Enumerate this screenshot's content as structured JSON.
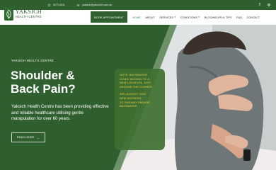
{
  "topbar": {
    "phone": "9271 6211",
    "email": "yaksich@yaksichh.com.au",
    "social": [
      {
        "name": "facebook-icon",
        "glyph": "f"
      },
      {
        "name": "instagram-icon",
        "glyph": "◎"
      }
    ]
  },
  "logo": {
    "name": "YAKSICH",
    "sub": "HEALTH CENTRE"
  },
  "nav": {
    "book_label": "BOOK APPOINTMENT",
    "items": [
      {
        "label": "HOME",
        "active": true
      },
      {
        "label": "ABOUT"
      },
      {
        "label": "SERVICES",
        "dropdown": true
      },
      {
        "label": "CONDITIONS",
        "dropdown": true
      },
      {
        "label": "BLOG/HELPFUL TIPS"
      },
      {
        "label": "FAQ"
      },
      {
        "label": "CONTACT"
      }
    ]
  },
  "hero": {
    "eyebrow": "YAKSICH HEALTH CENTRE",
    "headline_1": "Shoulder &",
    "headline_2": "Back Pain?",
    "lede": "Yaksich Health Centre has been providing effective and reliable healthcare utilising gentle manipulation for over 60 years.",
    "read_more": "READ MORE",
    "notice_lines_a": [
      "NOTE: BAYSWATER",
      "CLINIC MOVING TO A",
      "NEW LOCATION, JUST",
      "AROUND THE CORNER"
    ],
    "notice_lines_b": [
      "3RD AUGUST 2026",
      "NEW ADDRESS:",
      "2/2 RAILWAY PARADE,",
      "BAYSWATER"
    ]
  },
  "colors": {
    "brand_green": "#2f5f2f",
    "notice_text": "#f2d24a",
    "active_nav": "#3f8f3f"
  }
}
